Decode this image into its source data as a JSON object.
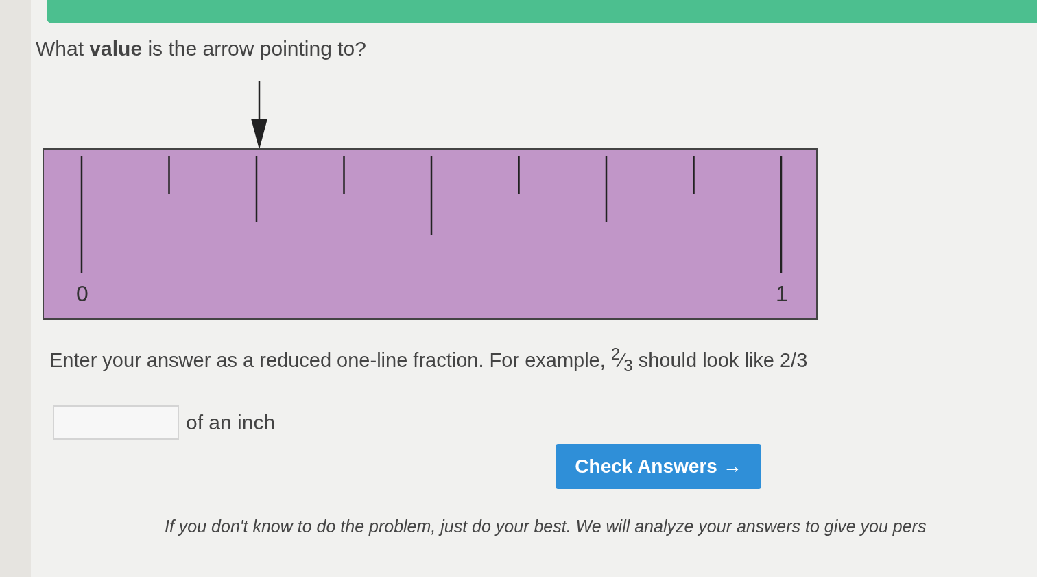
{
  "question": "What **value** is the arrow pointing to?",
  "ruler": {
    "labels": [
      "0",
      "1"
    ]
  },
  "instruction": "Enter your answer as a reduced one-line fraction. For example, $^{2}$⁄$_{3}$ should look like 2/3",
  "answer": {
    "unit": "of an inch"
  },
  "button": {
    "label": "Check Answers →"
  },
  "note": "If you don't know to do the problem, just do your best. We will analyze your answers to give you pers"
}
